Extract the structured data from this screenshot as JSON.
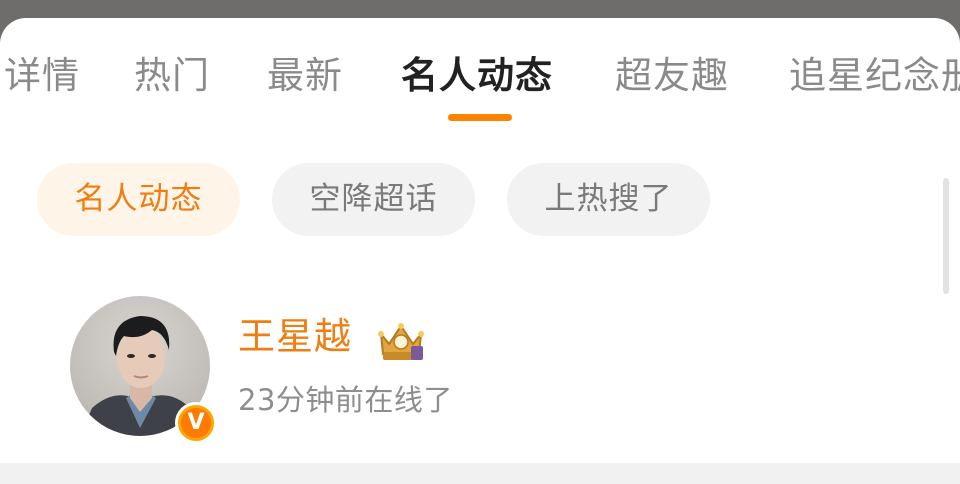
{
  "tabs": [
    {
      "label": "详情"
    },
    {
      "label": "热门"
    },
    {
      "label": "最新"
    },
    {
      "label": "名人动态",
      "active": true
    },
    {
      "label": "超友趣"
    },
    {
      "label": "追星纪念册"
    }
  ],
  "filters": [
    {
      "label": "名人动态",
      "active": true
    },
    {
      "label": "空降超话"
    },
    {
      "label": "上热搜了"
    }
  ],
  "user": {
    "name": "王星越",
    "status": "23分钟前在线了",
    "verified_badge": "V",
    "crown_icon": "crown-icon",
    "badge_color": "#ff8200"
  },
  "colors": {
    "accent": "#f07d12",
    "indicator": "#ff8200",
    "chip_bg": "#f2f2f2",
    "chip_active_bg": "#fff4e8"
  }
}
